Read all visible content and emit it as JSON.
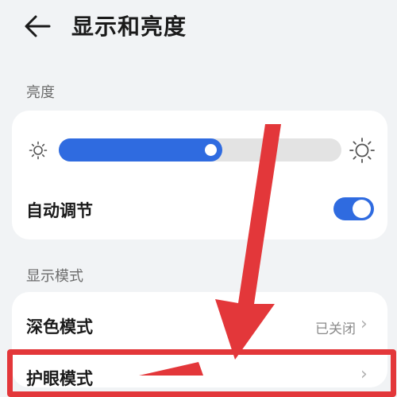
{
  "header": {
    "title": "显示和亮度",
    "back_icon": "arrow-left-icon"
  },
  "brightness": {
    "section_label": "亮度",
    "level": 0.58,
    "low_icon": "sun-small-icon",
    "high_icon": "sun-large-icon",
    "auto_label": "自动调节",
    "auto_enabled": true
  },
  "display_mode": {
    "section_label": "显示模式",
    "dark_mode_label": "深色模式",
    "dark_mode_value": "已关闭",
    "eye_comfort_label": "护眼模式"
  },
  "colors": {
    "accent": "#2f6be0",
    "annotation": "#e3373a",
    "background": "#f1f3f5"
  }
}
